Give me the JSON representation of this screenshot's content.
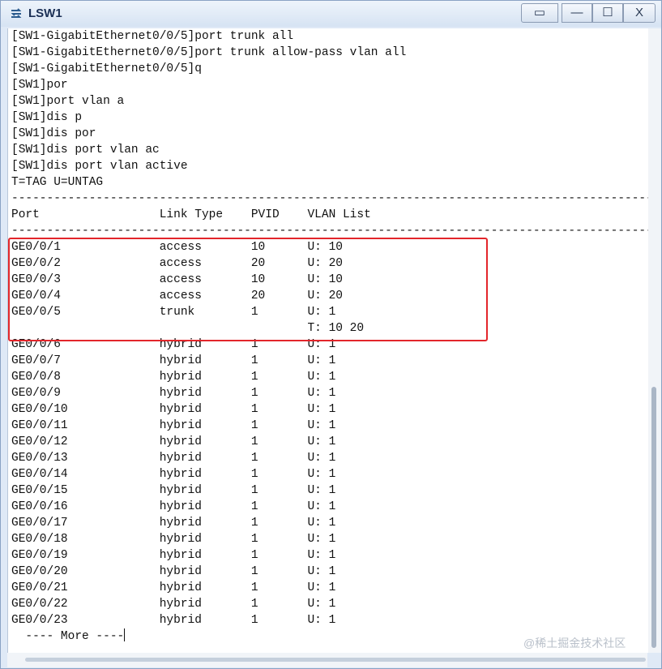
{
  "window": {
    "title": "LSW1"
  },
  "controls": {
    "extra": "▭",
    "minimize": "—",
    "maximize": "☐",
    "close": "X"
  },
  "terminal": {
    "lines": [
      "[SW1-GigabitEthernet0/0/5]port trunk all",
      "[SW1-GigabitEthernet0/0/5]port trunk allow-pass vlan all",
      "[SW1-GigabitEthernet0/0/5]q",
      "[SW1]por",
      "[SW1]port vlan a",
      "[SW1]dis p",
      "[SW1]dis por",
      "[SW1]dis port vlan ac",
      "[SW1]dis port vlan active",
      "T=TAG U=UNTAG",
      "------------------------------------------------------------------------------------------------",
      "Port                 Link Type    PVID    VLAN List",
      "------------------------------------------------------------------------------------------------",
      "GE0/0/1              access       10      U: 10",
      "GE0/0/2              access       20      U: 20",
      "GE0/0/3              access       10      U: 10",
      "GE0/0/4              access       20      U: 20",
      "GE0/0/5              trunk        1       U: 1",
      "                                          T: 10 20",
      "GE0/0/6              hybrid       1       U: 1",
      "GE0/0/7              hybrid       1       U: 1",
      "GE0/0/8              hybrid       1       U: 1",
      "GE0/0/9              hybrid       1       U: 1",
      "GE0/0/10             hybrid       1       U: 1",
      "GE0/0/11             hybrid       1       U: 1",
      "GE0/0/12             hybrid       1       U: 1",
      "GE0/0/13             hybrid       1       U: 1",
      "GE0/0/14             hybrid       1       U: 1",
      "GE0/0/15             hybrid       1       U: 1",
      "GE0/0/16             hybrid       1       U: 1",
      "GE0/0/17             hybrid       1       U: 1",
      "GE0/0/18             hybrid       1       U: 1",
      "GE0/0/19             hybrid       1       U: 1",
      "GE0/0/20             hybrid       1       U: 1",
      "GE0/0/21             hybrid       1       U: 1",
      "GE0/0/22             hybrid       1       U: 1",
      "GE0/0/23             hybrid       1       U: 1"
    ],
    "more_prompt": "  ---- More ----"
  },
  "watermark": "@稀土掘金技术社区",
  "colors": {
    "highlight": "#e3262b",
    "title": "#1a2f55"
  }
}
